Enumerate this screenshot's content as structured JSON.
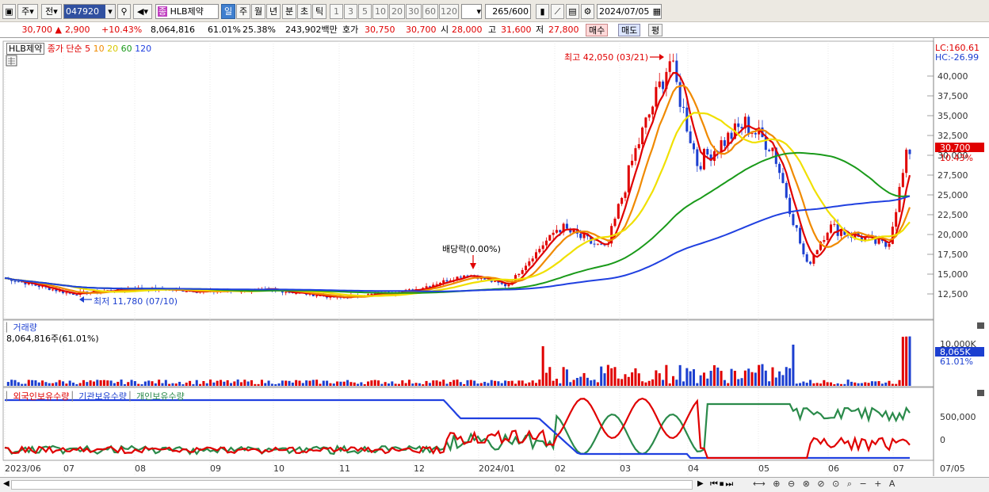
{
  "toolbar": {
    "market_label": "주",
    "prev_label": "전",
    "stock_code": "047920",
    "stock_name": "HLB제약",
    "period_buttons": [
      "일",
      "주",
      "월",
      "년",
      "분",
      "초",
      "틱"
    ],
    "active_period": "일",
    "interval_buttons": [
      "1",
      "3",
      "5",
      "10",
      "20",
      "30",
      "60",
      "120"
    ],
    "bar_count": "265",
    "bar_total": "/600",
    "date": "2024/07/05"
  },
  "quote": {
    "price": "30,700",
    "change": "2,900",
    "change_pct": "+10.43%",
    "volume": "8,064,816",
    "vol_ratio": "61.01%",
    "turnover": "25.38%",
    "amount": "243,902백만",
    "ask_label": "호가",
    "ask": "30,750",
    "bid": "30,700",
    "open_label": "시",
    "open": "28,000",
    "high_label": "고",
    "high": "31,600",
    "low_label": "저",
    "low": "27,800",
    "buy_label": "매수",
    "sell_label": "매도",
    "flat_label": "평"
  },
  "price_pane": {
    "legend_name": "HLB제약",
    "legend_ma": "종가 단순",
    "ma_periods": [
      "5",
      "10",
      "20",
      "60",
      "120"
    ],
    "ma_colors": [
      "#e00000",
      "#f08a00",
      "#f0e000",
      "#1a9a1a",
      "#2040e0"
    ],
    "lc_label": "LC:160.61",
    "hc_label": "HC:-26.99",
    "high_note": "최고 42,050 (03/21)",
    "low_note": "최저 11,780 (07/10)",
    "dividend_note": "배당락(0.00%)",
    "current_price_tag": "30,700",
    "current_pct_tag": "10.43%"
  },
  "volume_pane": {
    "title": "거래량",
    "value_text": "8,064,816주(61.01%)",
    "axis_label": "10,000K",
    "current_tag": "8,065K",
    "pct_tag": "61.01%"
  },
  "holding_pane": {
    "legend": [
      "외국인보유수량",
      "기관보유수량",
      "개인보유수량"
    ],
    "colors": [
      "#e00000",
      "#2040e0",
      "#2a8a4a"
    ],
    "axis_labels": [
      "500,000",
      "0"
    ]
  },
  "x_axis": [
    "2023/06",
    "07",
    "08",
    "09",
    "10",
    "11",
    "12",
    "2024/01",
    "02",
    "03",
    "04",
    "05",
    "06",
    "07",
    "07/05"
  ],
  "chart_data": {
    "type": "candlestick",
    "title": "HLB제약",
    "y_axis_labels": [
      40000,
      37500,
      35000,
      32500,
      30000,
      27500,
      25000,
      22500,
      20000,
      17500,
      15000,
      12500
    ],
    "ylim": [
      10000,
      43000
    ],
    "price_series": [
      {
        "date": "2023/06",
        "close": 14500
      },
      {
        "date": "2023/07",
        "close": 12500
      },
      {
        "date": "2023/08",
        "close": 13200
      },
      {
        "date": "2023/09",
        "close": 12800
      },
      {
        "date": "2023/10",
        "close": 13000
      },
      {
        "date": "2023/11",
        "close": 12000
      },
      {
        "date": "2023/12",
        "close": 13000
      },
      {
        "date": "2023/12/28",
        "close": 15000
      },
      {
        "date": "2024/01",
        "close": 13500
      },
      {
        "date": "2024/02",
        "close": 21000
      },
      {
        "date": "2024/02/20",
        "close": 18000
      },
      {
        "date": "2024/03",
        "close": 30000
      },
      {
        "date": "2024/03/21",
        "close": 42050
      },
      {
        "date": "2024/04",
        "close": 29000
      },
      {
        "date": "2024/04/25",
        "close": 34000
      },
      {
        "date": "2024/05",
        "close": 31000
      },
      {
        "date": "2024/05/20",
        "close": 16000
      },
      {
        "date": "2024/06",
        "close": 21000
      },
      {
        "date": "2024/06/28",
        "close": 18500
      },
      {
        "date": "2024/07/05",
        "close": 30700
      }
    ],
    "volume": {
      "current": 8065,
      "unit": "K",
      "ymax_label": 10000
    }
  }
}
